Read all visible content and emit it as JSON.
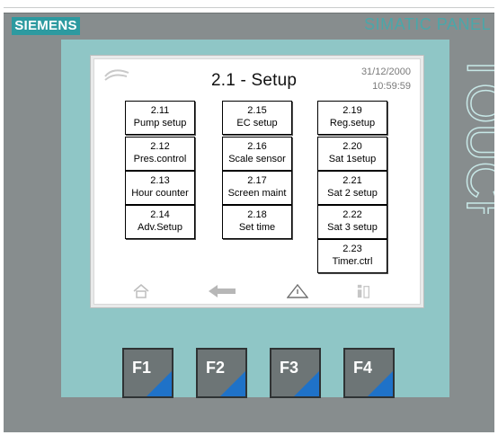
{
  "brand": "SIEMENS",
  "model": "SIMATIC PANEL",
  "touch_word": "TOUCH",
  "screen": {
    "title": "2.1 - Setup",
    "date": "31/12/2000",
    "time": "10:59:59",
    "tiles": [
      {
        "num": "2.11",
        "label": "Pump setup"
      },
      {
        "num": "2.12",
        "label": "Pres.control"
      },
      {
        "num": "2.13",
        "label": "Hour counter"
      },
      {
        "num": "2.14",
        "label": "Adv.Setup"
      },
      {
        "num": "2.15",
        "label": "EC setup"
      },
      {
        "num": "2.16",
        "label": "Scale sensor"
      },
      {
        "num": "2.17",
        "label": "Screen maint"
      },
      {
        "num": "2.18",
        "label": "Set time"
      },
      {
        "num": "2.19",
        "label": "Reg.setup"
      },
      {
        "num": "2.20",
        "label": "Sat 1setup"
      },
      {
        "num": "2.21",
        "label": "Sat 2 setup"
      },
      {
        "num": "2.22",
        "label": "Sat 3 setup"
      },
      {
        "num": "2.23",
        "label": "Timer.ctrl"
      }
    ],
    "footer_icons": [
      "home-icon",
      "back-arrow-icon",
      "warning-icon",
      "info-icon"
    ]
  },
  "function_keys": [
    "F1",
    "F2",
    "F3",
    "F4"
  ],
  "colors": {
    "panel": "#878d8e",
    "bezel": "#8fc6c6",
    "brand": "#2d9aa0",
    "key_accent": "#1f72c8"
  }
}
